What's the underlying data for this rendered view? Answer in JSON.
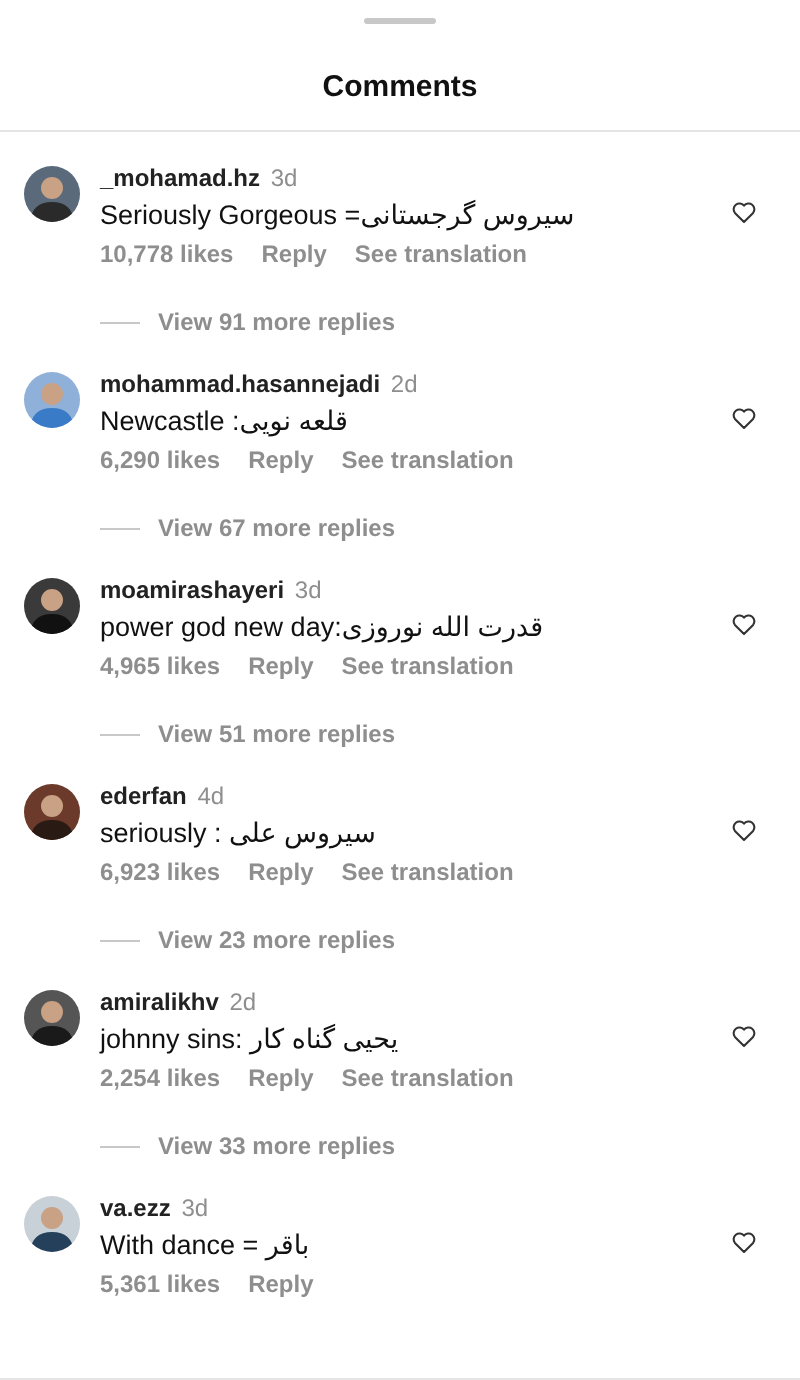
{
  "title": "Comments",
  "comments": [
    {
      "username": "_mohamad.hz",
      "time": "3d",
      "text": "Seriously Gorgeous =سیروس گرجستانی",
      "likes": "10,778 likes",
      "reply": "Reply",
      "translate": "See translation",
      "replies": "View 91 more replies"
    },
    {
      "username": "mohammad.hasannejadi",
      "time": "2d",
      "text": "Newcastle :قلعه نویی",
      "likes": "6,290 likes",
      "reply": "Reply",
      "translate": "See translation",
      "replies": "View 67 more replies"
    },
    {
      "username": "moamirashayeri",
      "time": "3d",
      "text": "power god new day:قدرت الله نوروزی",
      "likes": "4,965 likes",
      "reply": "Reply",
      "translate": "See translation",
      "replies": "View 51 more replies"
    },
    {
      "username": "ederfan",
      "time": "4d",
      "text": "seriously : سیروس علی",
      "likes": "6,923 likes",
      "reply": "Reply",
      "translate": "See translation",
      "replies": "View 23 more replies"
    },
    {
      "username": "amiralikhv",
      "time": "2d",
      "text": "johnny sins: یحیی گناه کار",
      "likes": "2,254 likes",
      "reply": "Reply",
      "translate": "See translation",
      "replies": "View 33 more replies"
    },
    {
      "username": "va.ezz",
      "time": "3d",
      "text": "With dance = باقر",
      "likes": "5,361 likes",
      "reply": "Reply"
    }
  ]
}
